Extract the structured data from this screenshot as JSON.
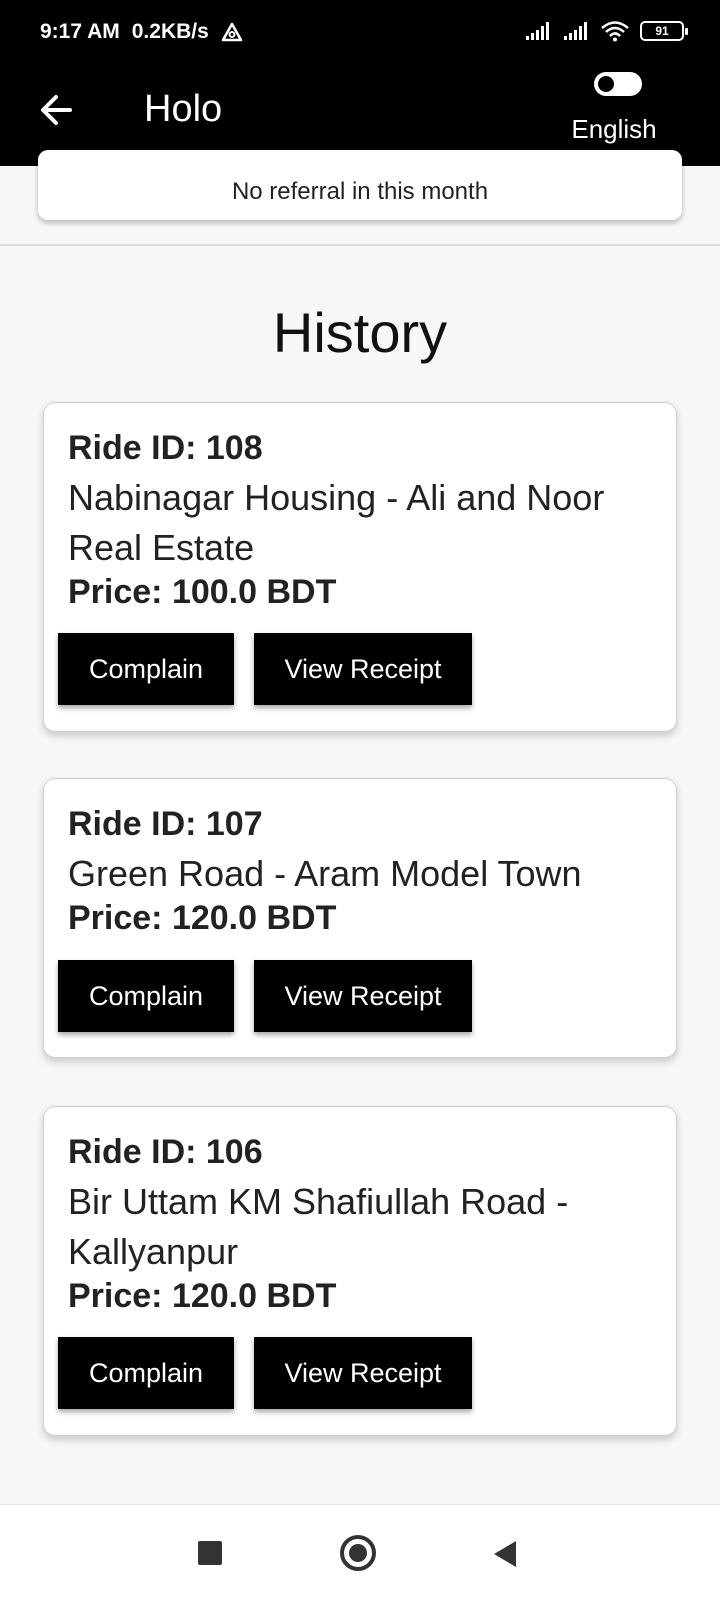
{
  "status_bar": {
    "time": "9:17 AM",
    "speed": "0.2KB/s",
    "battery": "91",
    "icons": [
      "signal-icon",
      "signal-icon",
      "wifi-icon",
      "battery-icon"
    ]
  },
  "app_bar": {
    "title": "Holo",
    "language_label": "English"
  },
  "referral": {
    "message": "No referral in this month"
  },
  "history": {
    "title": "History",
    "rides": [
      {
        "ride_id": "Ride ID: 108",
        "route": "Nabinagar Housing - Ali and Noor Real Estate",
        "price": "Price: 100.0 BDT",
        "complain_label": "Complain",
        "receipt_label": "View Receipt"
      },
      {
        "ride_id": "Ride ID: 107",
        "route": "Green Road - Aram Model Town",
        "price": "Price: 120.0 BDT",
        "complain_label": "Complain",
        "receipt_label": "View Receipt"
      },
      {
        "ride_id": "Ride ID: 106",
        "route": "Bir Uttam KM Shafiullah Road - Kallyanpur",
        "price": "Price: 120.0 BDT",
        "complain_label": "Complain",
        "receipt_label": "View Receipt"
      }
    ]
  },
  "colors": {
    "bar_background": "#000000",
    "button_background": "#000000",
    "page_background": "#f7f7f7"
  }
}
